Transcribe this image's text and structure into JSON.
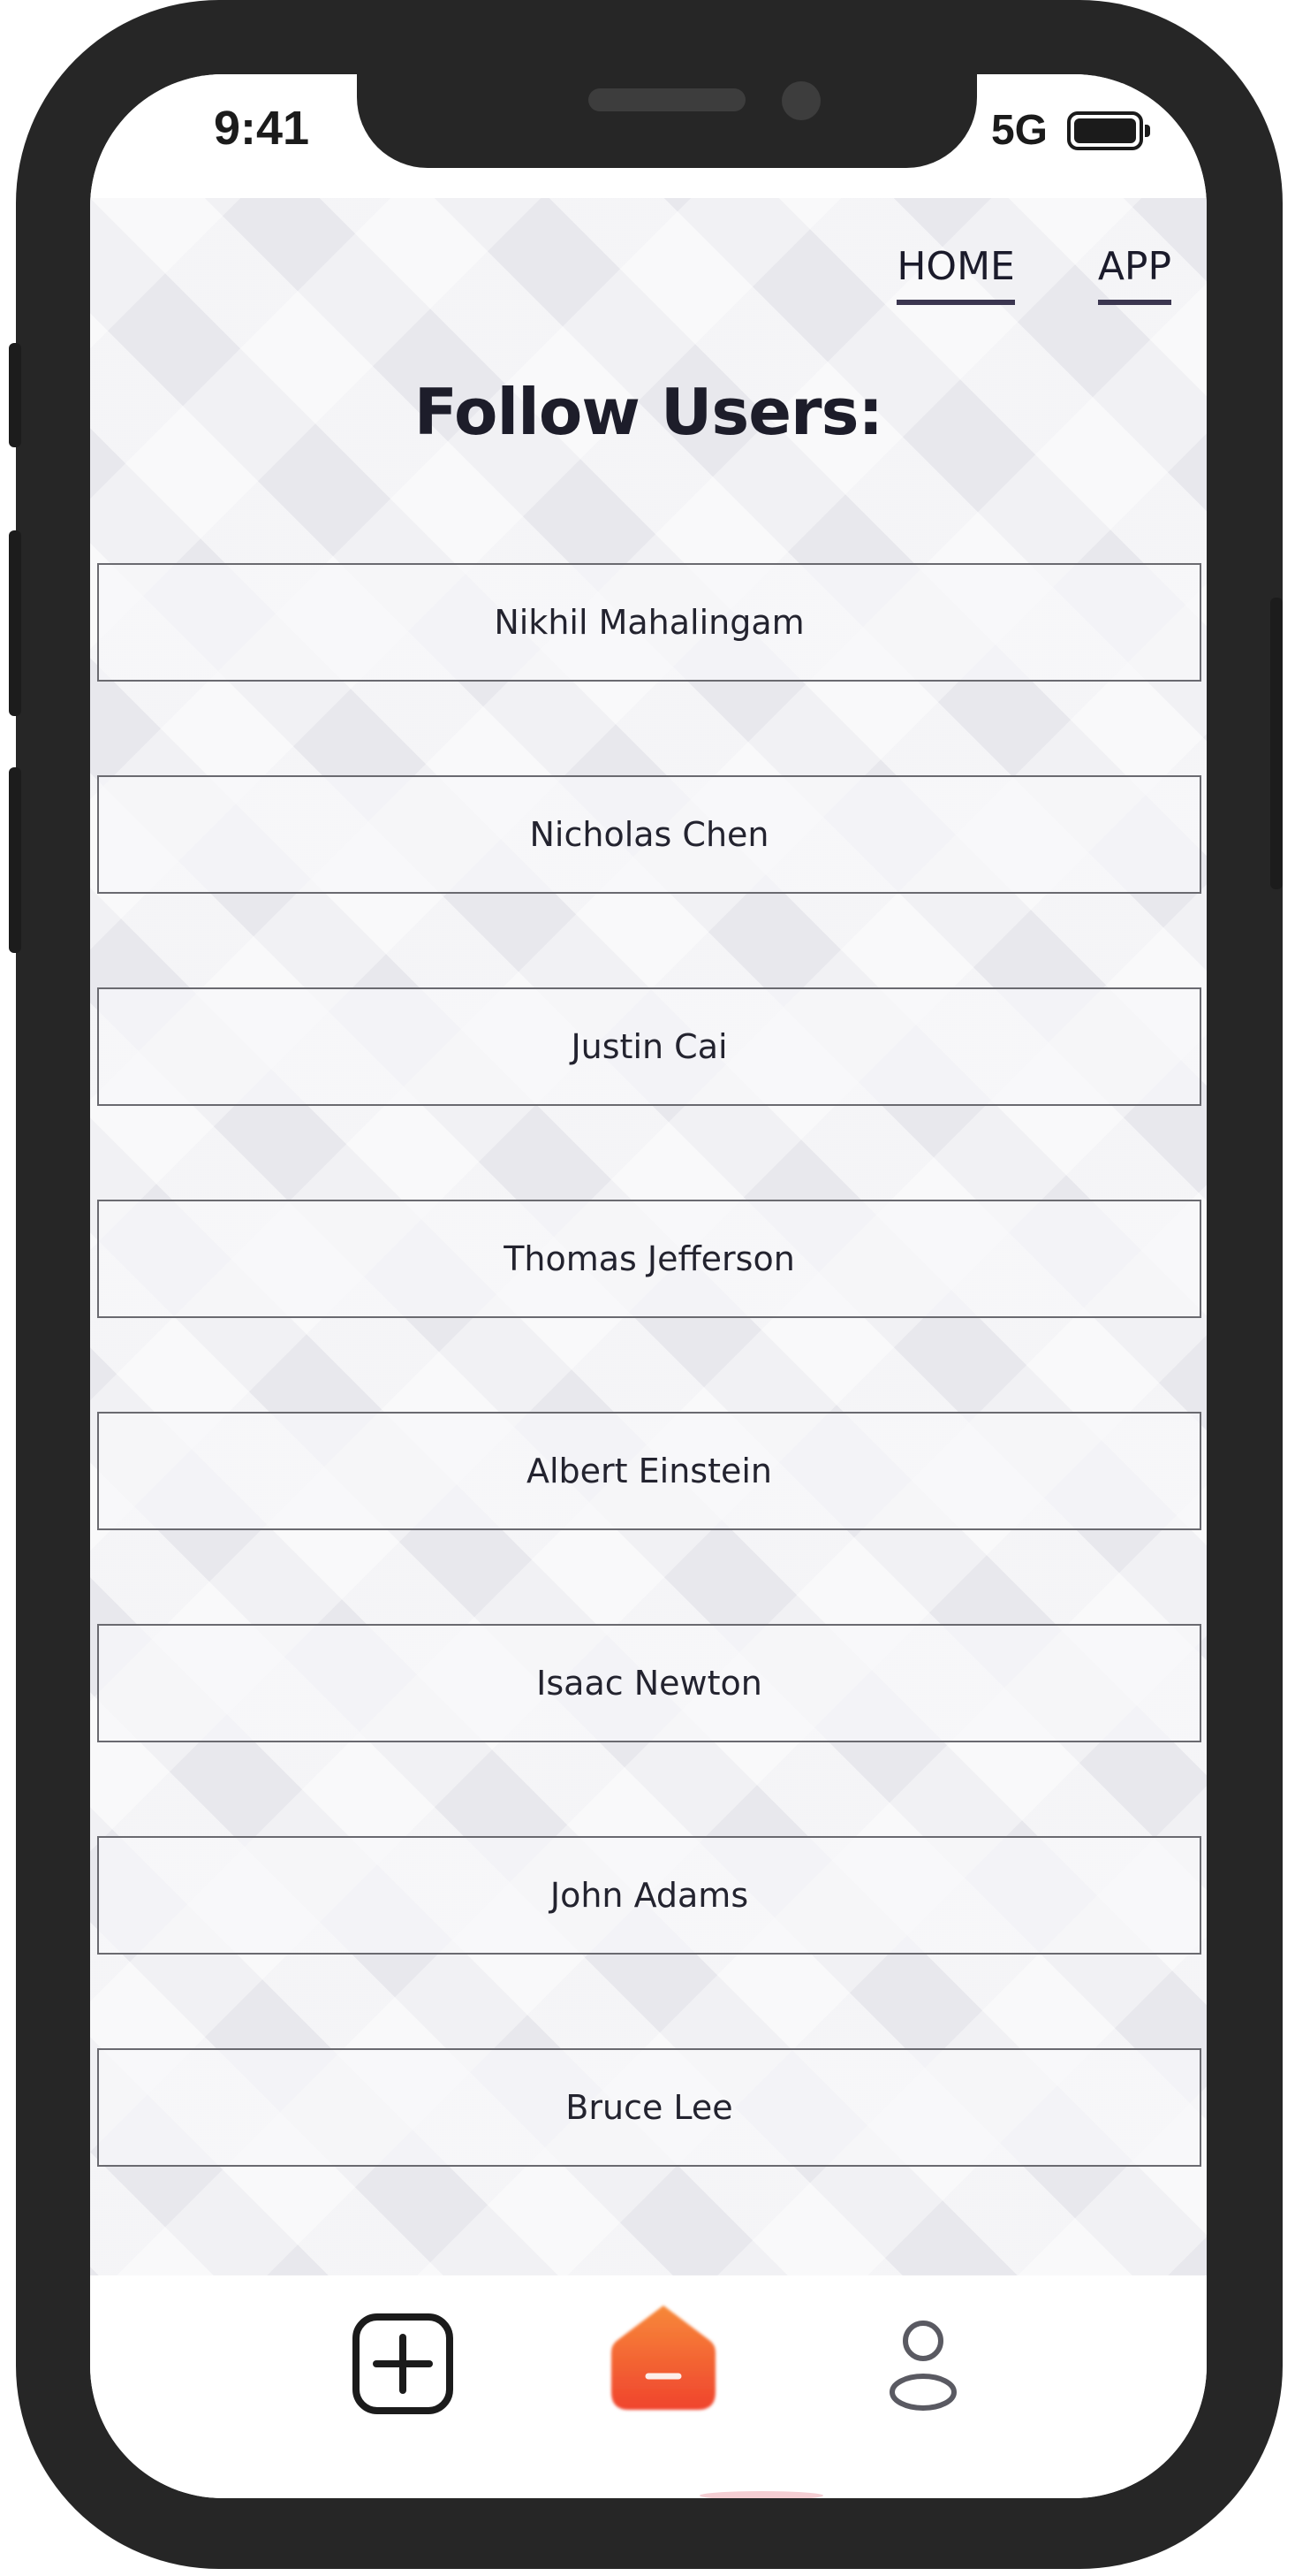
{
  "status_bar": {
    "time": "9:41",
    "network": "5G",
    "battery_icon": "battery-full-icon"
  },
  "nav": {
    "home_label": "HOME",
    "app_label": "APP"
  },
  "page": {
    "title": "Follow Users:"
  },
  "users": [
    "Nikhil Mahalingam",
    "Nicholas Chen",
    "Justin Cai",
    "Thomas Jefferson",
    "Albert Einstein",
    "Isaac Newton",
    "John Adams",
    "Bruce Lee"
  ],
  "tab_bar": {
    "items": [
      {
        "icon": "add-square-icon"
      },
      {
        "icon": "home-minus-icon"
      },
      {
        "icon": "user-icon"
      }
    ]
  },
  "colors": {
    "accent_orange": "#f36b2a",
    "accent_red": "#f0442d",
    "text_dark": "#1d1d2a",
    "nav_underline": "#3b3650"
  }
}
